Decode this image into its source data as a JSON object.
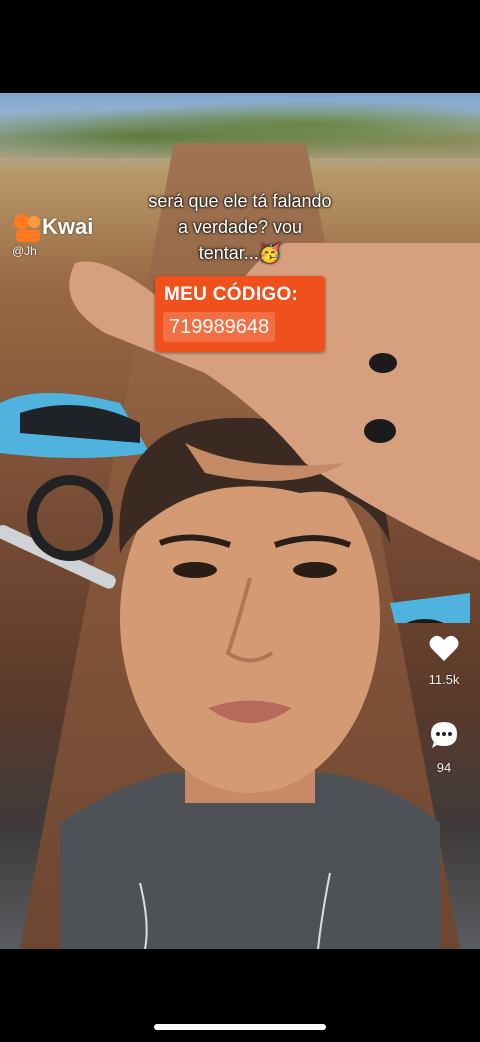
{
  "overlay": {
    "watermark_title": "Kwai",
    "watermark_user": "@Jh",
    "caption_lines": [
      "será que ele tá falando",
      "a verdade? vou",
      "tentar...🥳"
    ],
    "code_label": "MEU CÓDIGO:",
    "code_value": "719989648",
    "code_bg_color": "#f0501c"
  },
  "actions": {
    "likes": "11.5k",
    "comments": "94",
    "icons": [
      "heart-icon",
      "comment-icon"
    ]
  },
  "colors": {
    "background": "#000000",
    "text": "#ffffff"
  }
}
